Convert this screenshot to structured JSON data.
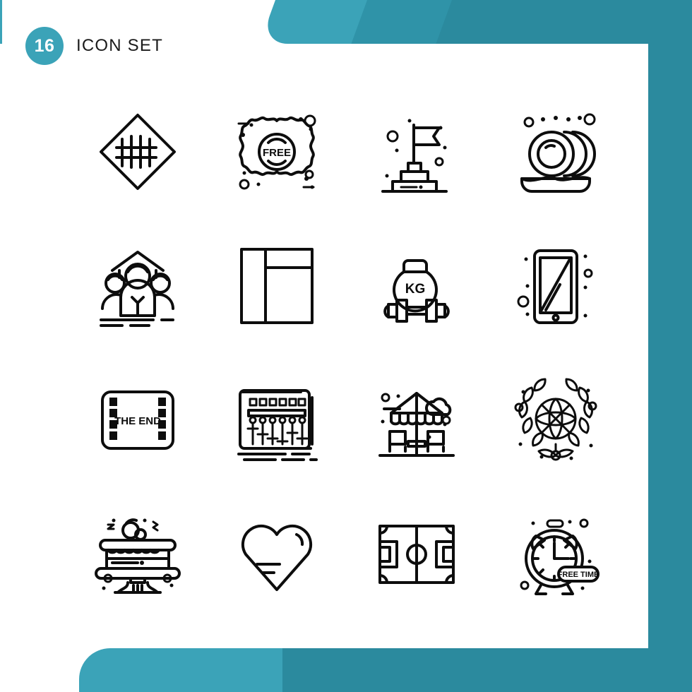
{
  "header": {
    "count": "16",
    "title": "Icon Set"
  },
  "theme": {
    "accent_light": "#3BA3B8",
    "accent_mid": "#2F93A8",
    "accent_dark": "#2B8A9E",
    "stroke": "#0d0d0d",
    "background": "#ffffff"
  },
  "grid": {
    "columns": 4,
    "rows": 4,
    "total": 16
  },
  "icons": [
    {
      "index": 1,
      "name": "fence-diamond-icon",
      "label": "Fence"
    },
    {
      "index": 2,
      "name": "free-badge-icon",
      "label": "Free Badge",
      "text": "FREE"
    },
    {
      "index": 3,
      "name": "flag-podium-icon",
      "label": "Flag Podium"
    },
    {
      "index": 4,
      "name": "stacked-plates-icon",
      "label": "Stacked Plates"
    },
    {
      "index": 5,
      "name": "team-group-icon",
      "label": "Team"
    },
    {
      "index": 6,
      "name": "layout-grid-icon",
      "label": "Layout"
    },
    {
      "index": 7,
      "name": "kg-dumbbell-icon",
      "label": "Weight",
      "text": "KG"
    },
    {
      "index": 8,
      "name": "tablet-device-icon",
      "label": "Tablet"
    },
    {
      "index": 9,
      "name": "film-the-end-icon",
      "label": "The End",
      "text": "THE END"
    },
    {
      "index": 10,
      "name": "audio-mixer-icon",
      "label": "Mixer"
    },
    {
      "index": 11,
      "name": "patio-umbrella-icon",
      "label": "Patio Umbrella"
    },
    {
      "index": 12,
      "name": "basketball-wreath-icon",
      "label": "Basketball Wreath"
    },
    {
      "index": 13,
      "name": "cake-stand-icon",
      "label": "Cake"
    },
    {
      "index": 14,
      "name": "heart-icon",
      "label": "Heart"
    },
    {
      "index": 15,
      "name": "soccer-field-icon",
      "label": "Soccer Field"
    },
    {
      "index": 16,
      "name": "alarm-clock-icon",
      "label": "Alarm Clock",
      "text": "FREE TIME"
    }
  ]
}
